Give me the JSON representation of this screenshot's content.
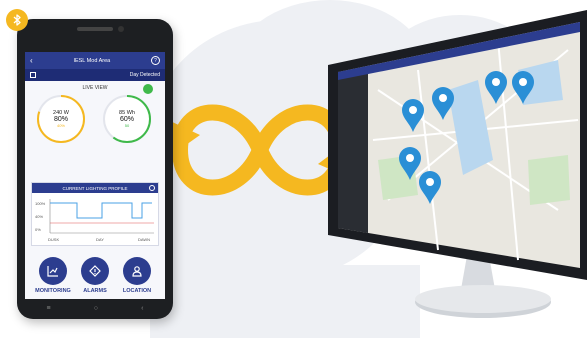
{
  "phone": {
    "header_title": "IESL Mod Area",
    "subheader_status": "Day Detected",
    "live_view_title": "LIVE VIEW",
    "gauge_power": {
      "label": "240 W",
      "percent": "80%",
      "sub": "40%",
      "level": 0.8,
      "color": "#f5b820"
    },
    "gauge_energy": {
      "label": "85 Wh",
      "percent": "60%",
      "sub": "50",
      "level": 0.6,
      "color": "#3fb94a"
    },
    "profile_title": "CURRENT LIGHTING PROFILE",
    "profile_y_ticks": [
      "100%",
      "40%",
      "0%"
    ],
    "profile_x_ticks": [
      "DUSK",
      "DAY",
      "DAWN"
    ],
    "nav": [
      {
        "label": "MONITORING",
        "icon": "chart-icon"
      },
      {
        "label": "ALARMS",
        "icon": "alarm-icon"
      },
      {
        "label": "LOCATION",
        "icon": "person-icon"
      }
    ]
  },
  "colors": {
    "brand_blue": "#2c3d8f",
    "accent_yellow": "#f5b820",
    "pin_blue": "#2a8fd6",
    "status_green": "#3fb94a"
  },
  "monitor": {
    "map_pins": 6
  }
}
